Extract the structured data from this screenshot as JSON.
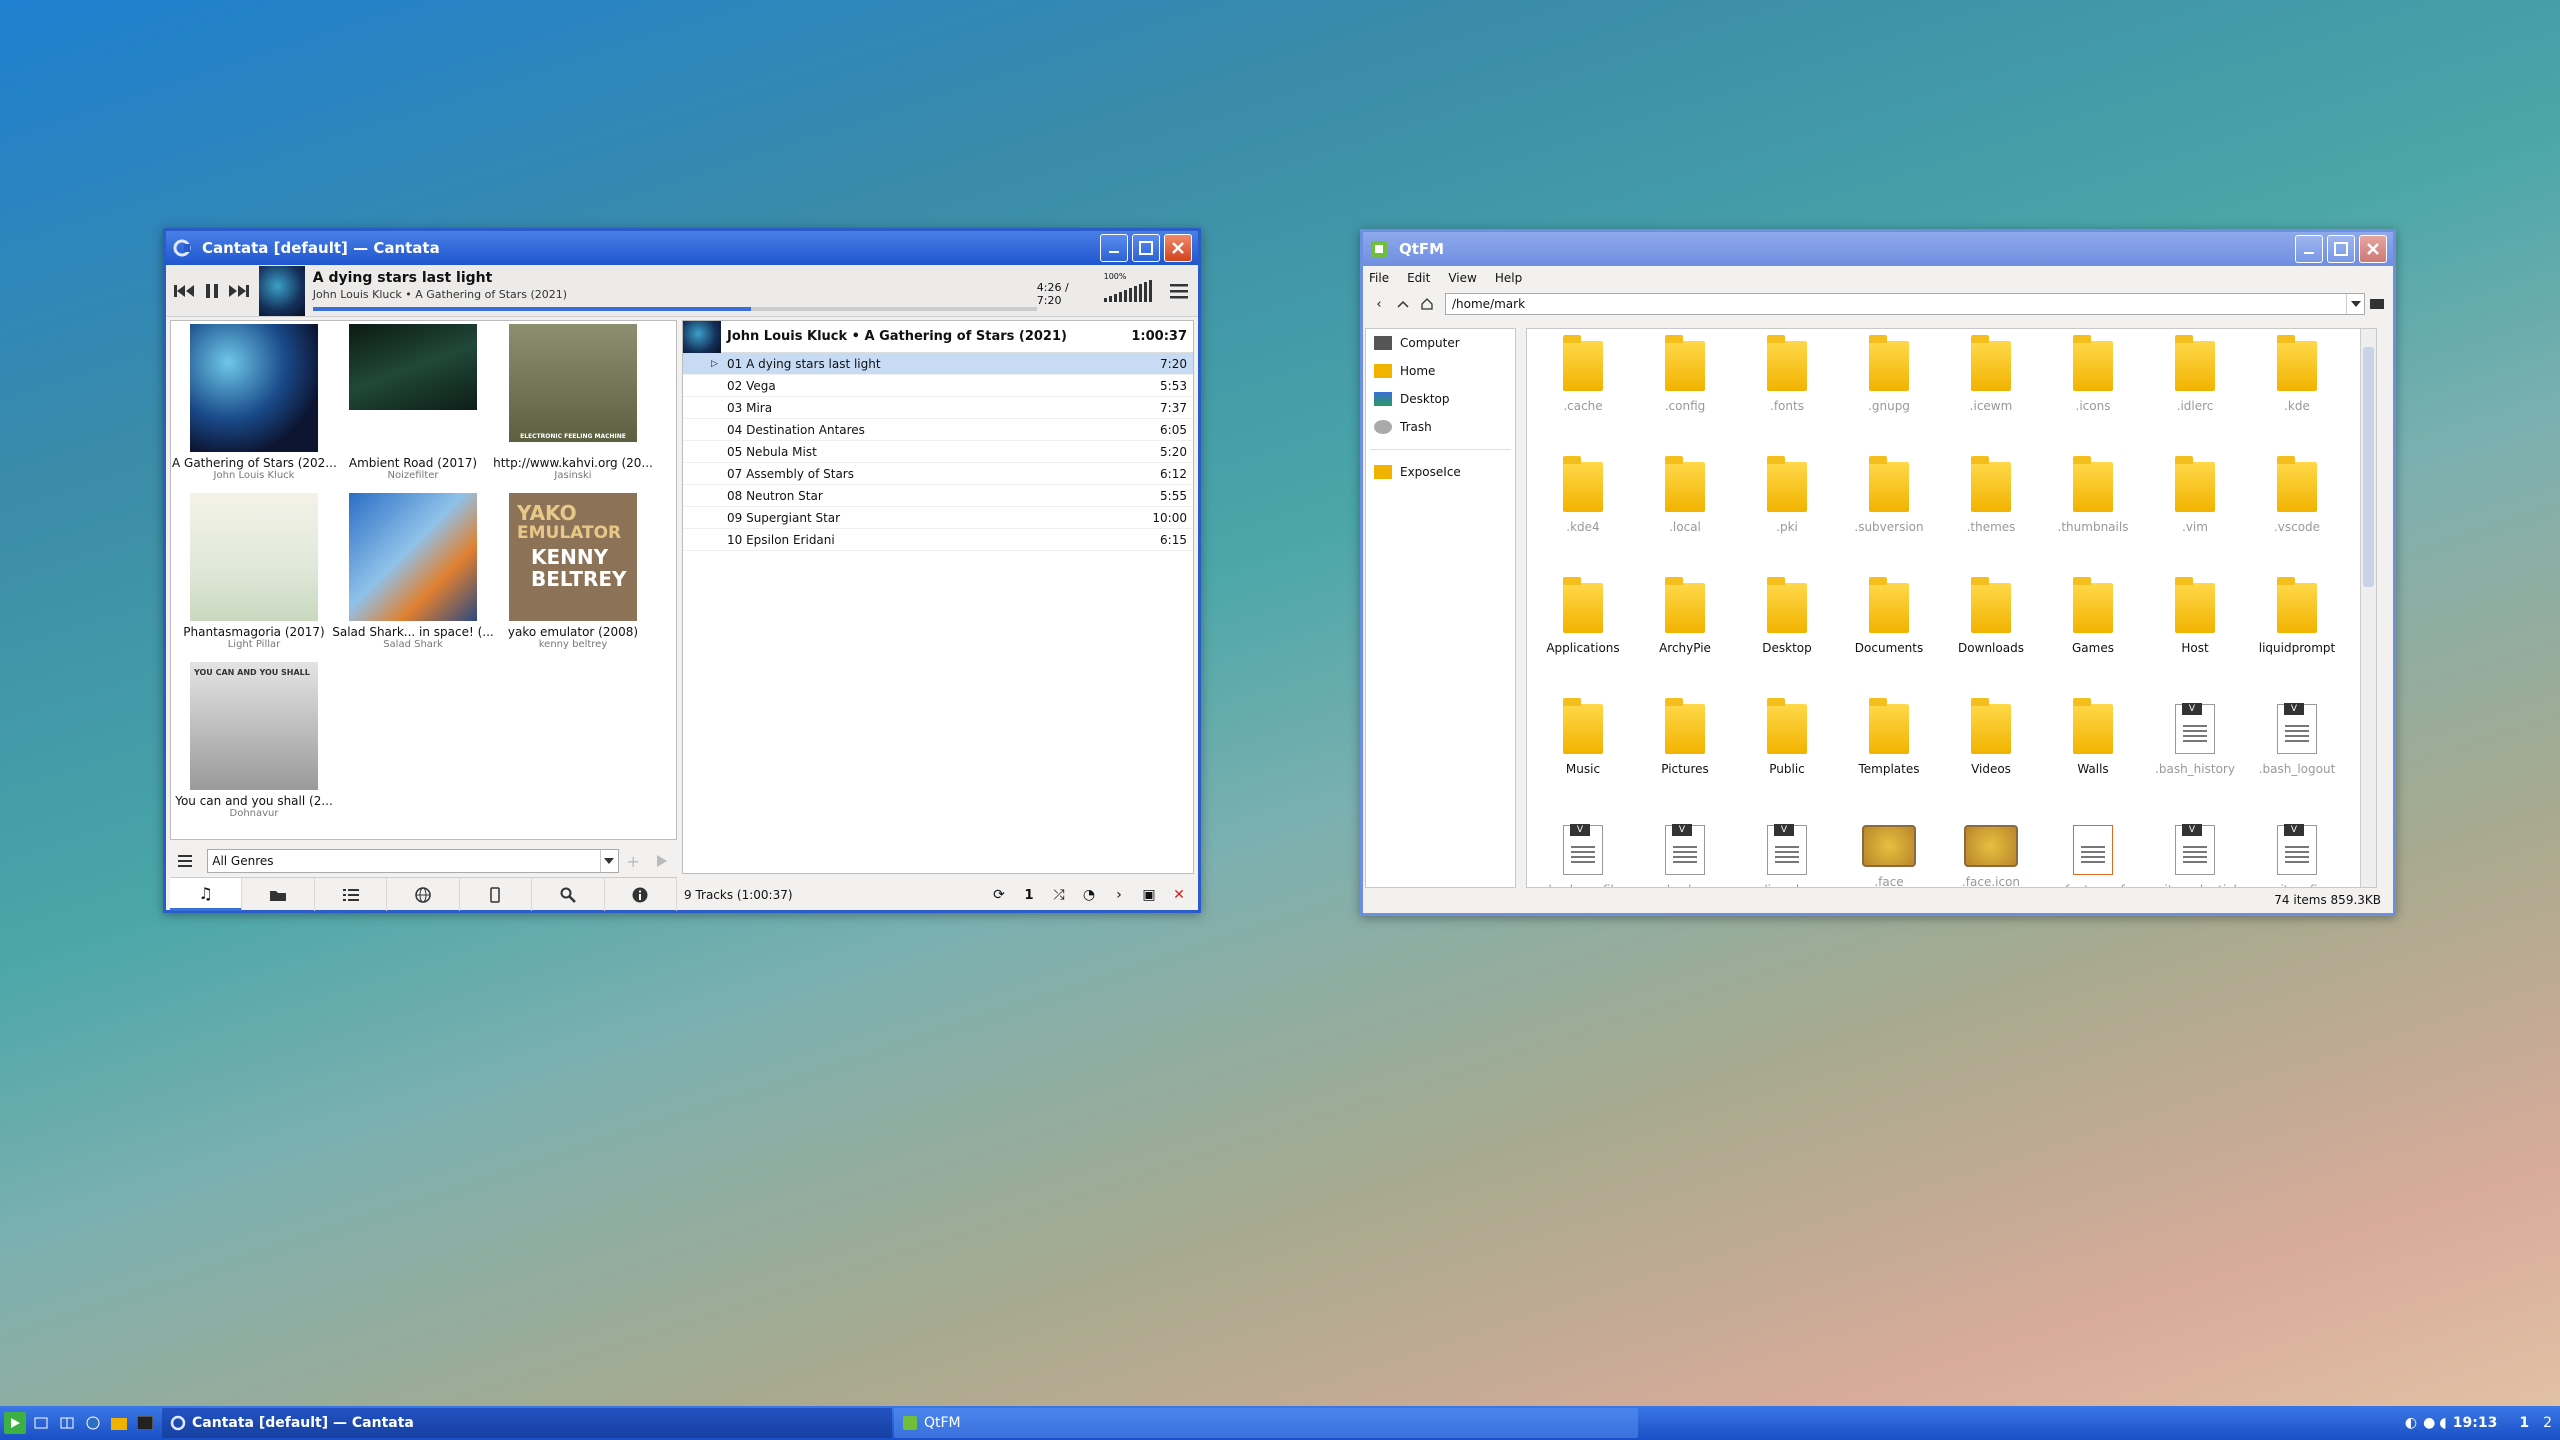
{
  "cantata": {
    "title": "Cantata [default] — Cantata",
    "now_playing": {
      "title": "A dying stars last light",
      "sub": "John Louis Kluck • A Gathering of Stars (2021)",
      "time": "4:26 / 7:20",
      "progress": 0.605
    },
    "volume_pct": "100%",
    "albums": [
      {
        "name": "A Gathering of Stars (202...",
        "artist": "John Louis Kluck"
      },
      {
        "name": "Ambient Road (2017)",
        "artist": "Noizefilter"
      },
      {
        "name": "http://www.kahvi.org (20...",
        "artist": "Jasinski"
      },
      {
        "name": "Phantasmagoria (2017)",
        "artist": "Light Pillar"
      },
      {
        "name": "Salad Shark... in space! (...",
        "artist": "Salad Shark"
      },
      {
        "name": "yako emulator (2008)",
        "artist": "kenny beltrey"
      },
      {
        "name": "You can and you shall (2...",
        "artist": "Dohnavur"
      }
    ],
    "genre": "All Genres",
    "queue": {
      "header": "John Louis Kluck • A Gathering of Stars (2021)",
      "duration": "1:00:37",
      "tracks": [
        {
          "name": "01 A dying stars last light",
          "len": "7:20"
        },
        {
          "name": "02 Vega",
          "len": "5:53"
        },
        {
          "name": "03 Mira",
          "len": "7:37"
        },
        {
          "name": "04 Destination Antares",
          "len": "6:05"
        },
        {
          "name": "05 Nebula Mist",
          "len": "5:20"
        },
        {
          "name": "07 Assembly of Stars",
          "len": "6:12"
        },
        {
          "name": "08 Neutron Star",
          "len": "5:55"
        },
        {
          "name": "09 Supergiant Star",
          "len": "10:00"
        },
        {
          "name": "10 Epsilon Eridani",
          "len": "6:15"
        }
      ],
      "status": "9 Tracks (1:00:37)",
      "single_label": "1"
    },
    "cover_texts": {
      "kahvi": "ELECTRONIC FEELING MACHINE",
      "yako1": "YAKO",
      "yako2": "EMULATOR",
      "yako3": "KENNY",
      "yako4": "BELTREY",
      "youcan": "YOU CAN AND YOU SHALL"
    }
  },
  "qtfm": {
    "title": "QtFM",
    "menu": [
      "File",
      "Edit",
      "View",
      "Help"
    ],
    "path": "/home/mark",
    "sidebar": [
      {
        "label": "Computer",
        "icon": "computer-icon"
      },
      {
        "label": "Home",
        "icon": "home-folder-icon"
      },
      {
        "label": "Desktop",
        "icon": "desktop-icon"
      },
      {
        "label": "Trash",
        "icon": "trash-icon"
      },
      {
        "label": "ExposeIce",
        "icon": "folder-icon"
      }
    ],
    "files": [
      {
        "name": ".cache",
        "type": "folder",
        "hidden": true
      },
      {
        "name": ".config",
        "type": "folder",
        "hidden": true
      },
      {
        "name": ".fonts",
        "type": "folder",
        "hidden": true
      },
      {
        "name": ".gnupg",
        "type": "folder",
        "hidden": true
      },
      {
        "name": ".icewm",
        "type": "folder",
        "hidden": true
      },
      {
        "name": ".icons",
        "type": "folder",
        "hidden": true
      },
      {
        "name": ".idlerc",
        "type": "folder",
        "hidden": true
      },
      {
        "name": ".kde",
        "type": "folder",
        "hidden": true
      },
      {
        "name": ".kde4",
        "type": "folder",
        "hidden": true
      },
      {
        "name": ".local",
        "type": "folder",
        "hidden": true
      },
      {
        "name": ".pki",
        "type": "folder",
        "hidden": true
      },
      {
        "name": ".subversion",
        "type": "folder",
        "hidden": true
      },
      {
        "name": ".themes",
        "type": "folder",
        "hidden": true
      },
      {
        "name": ".thumbnails",
        "type": "folder",
        "hidden": true
      },
      {
        "name": ".vim",
        "type": "folder",
        "hidden": true
      },
      {
        "name": ".vscode",
        "type": "folder",
        "hidden": true
      },
      {
        "name": "Applications",
        "type": "folder",
        "hidden": false
      },
      {
        "name": "ArchyPie",
        "type": "folder",
        "hidden": false
      },
      {
        "name": "Desktop",
        "type": "folder",
        "hidden": false
      },
      {
        "name": "Documents",
        "type": "folder",
        "hidden": false
      },
      {
        "name": "Downloads",
        "type": "folder",
        "hidden": false
      },
      {
        "name": "Games",
        "type": "folder",
        "hidden": false
      },
      {
        "name": "Host",
        "type": "folder",
        "hidden": false
      },
      {
        "name": "liquidprompt",
        "type": "folder",
        "hidden": false
      },
      {
        "name": "Music",
        "type": "folder",
        "hidden": false
      },
      {
        "name": "Pictures",
        "type": "folder",
        "hidden": false
      },
      {
        "name": "Public",
        "type": "folder",
        "hidden": false
      },
      {
        "name": "Templates",
        "type": "folder",
        "hidden": false
      },
      {
        "name": "Videos",
        "type": "folder",
        "hidden": false
      },
      {
        "name": "Walls",
        "type": "folder",
        "hidden": false
      },
      {
        "name": ".bash_history",
        "type": "doc",
        "hidden": true
      },
      {
        "name": ".bash_logout",
        "type": "doc",
        "hidden": true
      },
      {
        "name": ".bash_profile",
        "type": "doc",
        "hidden": true
      },
      {
        "name": ".bashrc",
        "type": "doc",
        "hidden": true
      },
      {
        "name": ".dir_colors",
        "type": "doc",
        "hidden": true
      },
      {
        "name": ".face",
        "type": "image",
        "hidden": true
      },
      {
        "name": ".face.icon",
        "type": "image",
        "hidden": true
      },
      {
        "name": ".fonts.conf",
        "type": "xml",
        "hidden": true
      },
      {
        "name": ".git-credential",
        "type": "doc",
        "hidden": true
      },
      {
        "name": ".gitconfig",
        "type": "doc",
        "hidden": true
      }
    ],
    "status": "74 items  859.3KB"
  },
  "taskbar": {
    "active_task": "Cantata [default] — Cantata",
    "other_task": "QtFM",
    "clock": "19:13",
    "workspaces": [
      "1",
      "2"
    ]
  }
}
